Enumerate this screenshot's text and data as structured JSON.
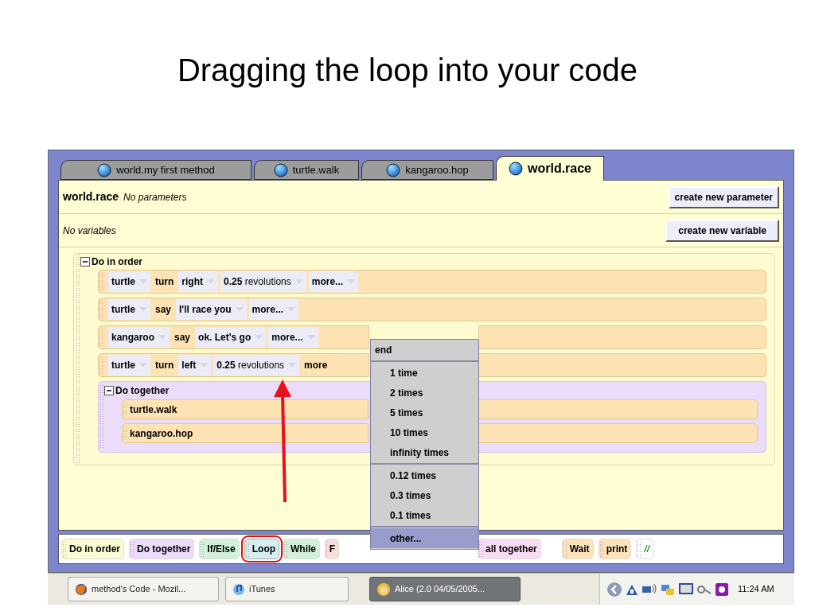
{
  "slide_title": "Dragging the loop into your code",
  "tabs": [
    {
      "label": "world.my first method",
      "selected": false
    },
    {
      "label": "turtle.walk",
      "selected": false
    },
    {
      "label": "kangaroo.hop",
      "selected": false
    },
    {
      "label": "world.race",
      "selected": true
    }
  ],
  "method_header": {
    "name": "world.race",
    "parameters": "No parameters",
    "button": "create new parameter"
  },
  "variables_header": {
    "text": "No variables",
    "button": "create new variable"
  },
  "do_in_order": {
    "label": "Do in order",
    "statements": [
      {
        "parts": [
          {
            "kind": "dropdown",
            "text": "turtle"
          },
          {
            "kind": "word",
            "text": "turn"
          },
          {
            "kind": "dropdown",
            "text": "right"
          },
          {
            "kind": "dropdown",
            "text": "**0.25** revolutions"
          },
          {
            "kind": "dropdown",
            "text": "more..."
          }
        ]
      },
      {
        "parts": [
          {
            "kind": "dropdown",
            "text": "turtle"
          },
          {
            "kind": "word",
            "text": "say"
          },
          {
            "kind": "dropdown",
            "text": "I'll race you"
          },
          {
            "kind": "dropdown",
            "text": "more..."
          }
        ]
      },
      {
        "parts": [
          {
            "kind": "dropdown",
            "text": "kangaroo"
          },
          {
            "kind": "word",
            "text": "say"
          },
          {
            "kind": "dropdown",
            "text": "ok. Let's go"
          },
          {
            "kind": "dropdown",
            "text": "more..."
          }
        ]
      },
      {
        "parts": [
          {
            "kind": "dropdown",
            "text": "turtle"
          },
          {
            "kind": "word",
            "text": "turn"
          },
          {
            "kind": "dropdown",
            "text": "left"
          },
          {
            "kind": "dropdown",
            "text": "**0.25** revolutions"
          },
          {
            "kind": "word",
            "text": "more"
          }
        ]
      }
    ],
    "do_together": {
      "label": "Do together",
      "statements": [
        "turtle.walk",
        "kangaroo.hop"
      ]
    }
  },
  "tiles": [
    {
      "label": "Do in order",
      "color": "#fdfbd2",
      "highlighted": false
    },
    {
      "label": "Do together",
      "color": "#ecdcfa",
      "highlighted": false
    },
    {
      "label": "If/Else",
      "color": "#d2f0dc",
      "highlighted": false
    },
    {
      "label": "Loop",
      "color": "#d4eef2",
      "highlighted": true
    },
    {
      "label": "While",
      "color": "#d2f0dc",
      "highlighted": false
    },
    {
      "label": "F",
      "color": "#fadcdc",
      "highlighted": false
    },
    {
      "label": "all together",
      "color": "#f8dcf4",
      "highlighted": false
    },
    {
      "label": "Wait",
      "color": "#fde3b8",
      "highlighted": false
    },
    {
      "label": "print",
      "color": "#fde3b8",
      "highlighted": false
    },
    {
      "label": "//",
      "color": "#ffffff",
      "highlighted": false
    }
  ],
  "loop_menu": {
    "header": "end",
    "groups": [
      [
        {
          "label": "1 time",
          "selected": false
        },
        {
          "label": "2 times",
          "selected": false
        },
        {
          "label": "5 times",
          "selected": false
        },
        {
          "label": "10 times",
          "selected": false
        },
        {
          "label": "infinity times",
          "selected": false
        }
      ],
      [
        {
          "label": "0.12 times",
          "selected": false
        },
        {
          "label": "0.3 times",
          "selected": false
        },
        {
          "label": "0.1 times",
          "selected": false
        }
      ],
      [
        {
          "label": "other...",
          "selected": true
        }
      ]
    ]
  },
  "taskbar": {
    "buttons": [
      {
        "label": "method's Code - Mozil...",
        "active": false
      },
      {
        "label": "iTunes",
        "active": false
      },
      {
        "label": "Alice (2.0 04/05/2005...",
        "active": true
      }
    ],
    "clock": "11:24 AM"
  }
}
